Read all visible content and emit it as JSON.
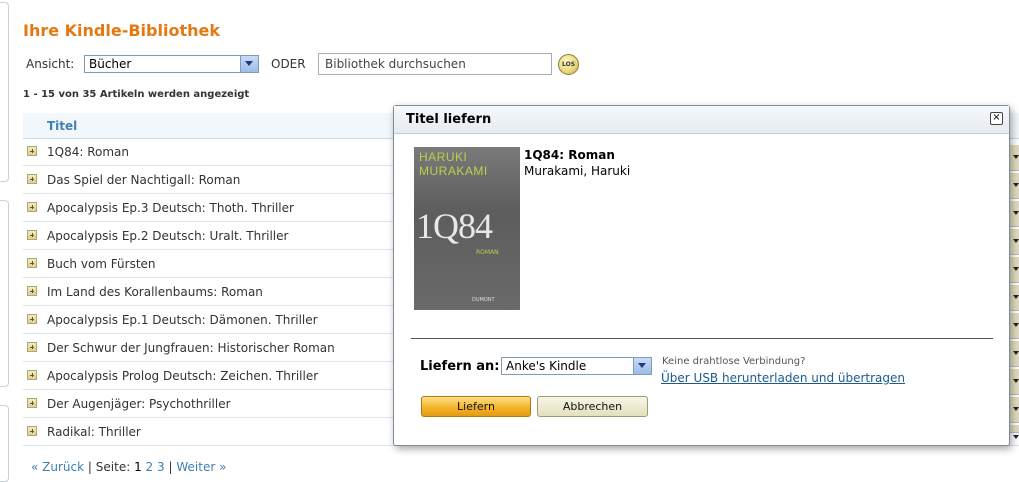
{
  "page": {
    "title": "Ihre Kindle-Bibliothek",
    "view_label": "Ansicht:",
    "view_value": "Bücher",
    "or_label": "ODER",
    "search_value": "Bibliothek durchsuchen",
    "search_button": "LOS",
    "result_count": "1 - 15 von 35 Artikeln werden angezeigt"
  },
  "table": {
    "column_title": "Titel",
    "rows": [
      "1Q84: Roman",
      "Das Spiel der Nachtigall: Roman",
      "Apocalypsis Ep.3 Deutsch: Thoth. Thriller",
      "Apocalypsis Ep.2 Deutsch: Uralt. Thriller",
      "Buch vom Fürsten",
      "Im Land des Korallenbaums: Roman",
      "Apocalypsis Ep.1 Deutsch: Dämonen. Thriller",
      "Der Schwur der Jungfrauen: Historischer Roman",
      "Apocalypsis Prolog Deutsch: Zeichen. Thriller",
      "Der Augenjäger: Psychothriller",
      "Radikal: Thriller"
    ]
  },
  "pager": {
    "prev": "« Zurück",
    "sep1": "|",
    "page_label": "Seite:",
    "current": "1",
    "p2": "2",
    "p3": "3",
    "sep2": "|",
    "next": "Weiter »"
  },
  "dialog": {
    "title": "Titel liefern",
    "close": "×",
    "cover": {
      "author_line1": "HARUKI",
      "author_line2": "MURAKAMI",
      "title_art": "1Q84",
      "subtitle_art": "ROMAN",
      "publisher": "DUMONT"
    },
    "book_title": "1Q84: Roman",
    "book_author": "Murakami, Haruki",
    "deliver_to_label": "Liefern an:",
    "device_value": "Anke's Kindle",
    "no_wireless": "Keine drahtlose Verbindung?",
    "usb_link": "Über USB herunterladen und übertragen",
    "deliver_button": "Liefern",
    "cancel_button": "Abbrechen"
  },
  "colors": {
    "title_orange": "#e47911",
    "link_blue": "#3f7fb3",
    "deliver_button": "#f5b42a"
  }
}
